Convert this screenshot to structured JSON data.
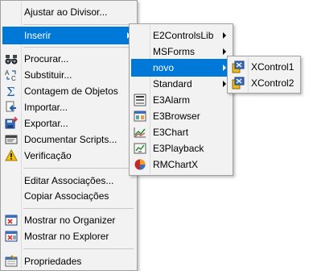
{
  "main_menu": {
    "items": [
      {
        "label": "Ajustar ao Divisor..."
      },
      {
        "label": "Inserir"
      },
      {
        "label": "Procurar..."
      },
      {
        "label": "Substituir..."
      },
      {
        "label": "Contagem de Objetos"
      },
      {
        "label": "Importar..."
      },
      {
        "label": "Exportar..."
      },
      {
        "label": "Documentar Scripts..."
      },
      {
        "label": "Verificação"
      },
      {
        "label": "Editar Associações..."
      },
      {
        "label": "Copiar Associações"
      },
      {
        "label": "Mostrar no Organizer"
      },
      {
        "label": "Mostrar no Explorer"
      },
      {
        "label": "Propriedades"
      }
    ]
  },
  "insert_submenu": {
    "items": [
      {
        "label": "E2ControlsLib"
      },
      {
        "label": "MSForms"
      },
      {
        "label": "novo"
      },
      {
        "label": "Standard"
      },
      {
        "label": "E3Alarm"
      },
      {
        "label": "E3Browser"
      },
      {
        "label": "E3Chart"
      },
      {
        "label": "E3Playback"
      },
      {
        "label": "RMChartX"
      }
    ]
  },
  "novo_submenu": {
    "items": [
      {
        "label": "XControl1"
      },
      {
        "label": "XControl2"
      }
    ]
  },
  "colors": {
    "highlight": "#0078d7",
    "menu_background": "#f2f2f2"
  }
}
